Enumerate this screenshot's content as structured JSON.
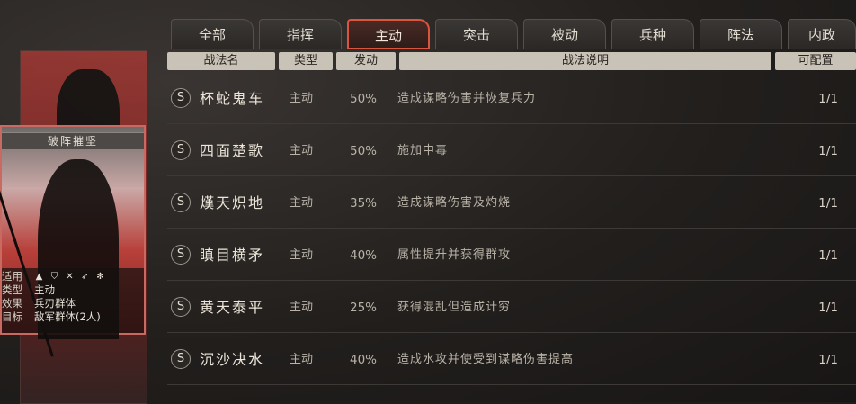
{
  "tabs": [
    "全部",
    "指挥",
    "主动",
    "突击",
    "被动",
    "兵种",
    "阵法",
    "内政"
  ],
  "active_tab": "主动",
  "columns": {
    "name": "战法名",
    "type": "类型",
    "rate": "发动",
    "desc": "战法说明",
    "config": "可配置"
  },
  "rows": [
    {
      "grade": "S",
      "name": "杯蛇鬼车",
      "type": "主动",
      "rate": "50%",
      "desc": "造成谋略伤害并恢复兵力",
      "config": "1/1"
    },
    {
      "grade": "S",
      "name": "四面楚歌",
      "type": "主动",
      "rate": "50%",
      "desc": "施加中毒",
      "config": "1/1"
    },
    {
      "grade": "S",
      "name": "熯天炽地",
      "type": "主动",
      "rate": "35%",
      "desc": "造成谋略伤害及灼烧",
      "config": "1/1"
    },
    {
      "grade": "S",
      "name": "瞋目横矛",
      "type": "主动",
      "rate": "40%",
      "desc": "属性提升并获得群攻",
      "config": "1/1"
    },
    {
      "grade": "S",
      "name": "黄天泰平",
      "type": "主动",
      "rate": "25%",
      "desc": "获得混乱但造成计穷",
      "config": "1/1"
    },
    {
      "grade": "S",
      "name": "沉沙决水",
      "type": "主动",
      "rate": "40%",
      "desc": "造成水攻并使受到谋略伤害提高",
      "config": "1/1"
    }
  ],
  "card": {
    "name": "破阵摧坚",
    "applies_label": "适用",
    "type_label": "类型",
    "type_value": "主动",
    "effect_label": "效果",
    "effect_value": "兵刃群体",
    "target_label": "目标",
    "target_value": "敌军群体(2人)",
    "unit_icons": [
      "cavalry-icon",
      "shield-icon",
      "crossed-swords-icon",
      "bow-icon",
      "wheel-icon"
    ]
  },
  "colors": {
    "active_tab_border": "#d9553f",
    "header_bg": "#c9c2b6",
    "card_red": "#b23a35"
  }
}
